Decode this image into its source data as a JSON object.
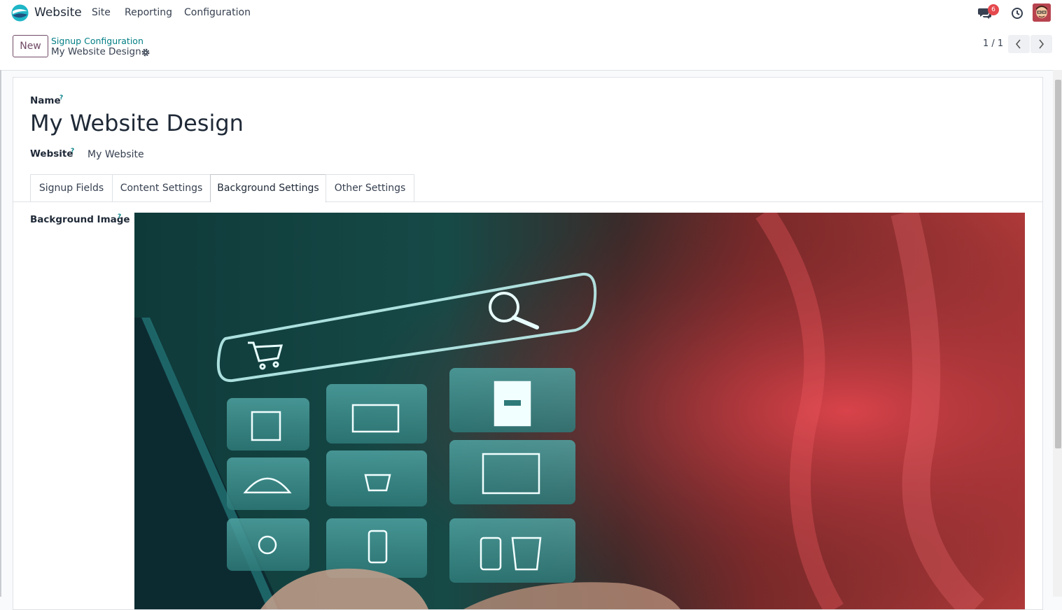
{
  "topbar": {
    "app_name": "Website",
    "menu": [
      "Site",
      "Reporting",
      "Configuration"
    ],
    "icons": {
      "chat": "chat-icon",
      "activity": "clock-icon",
      "avatar": "user-avatar"
    },
    "chat_badge": "6"
  },
  "control": {
    "new_label": "New",
    "breadcrumb_parent": "Signup Configuration",
    "breadcrumb_current": "My Website Design",
    "pager": "1 / 1"
  },
  "form": {
    "name_label": "Name",
    "help_mark": "?",
    "name_value": "My Website Design",
    "website_label": "Website",
    "website_value": "My Website",
    "tabs": [
      "Signup Fields",
      "Content Settings",
      "Background Settings",
      "Other Settings"
    ],
    "active_tab": "Background Settings",
    "background_image_label": "Background Image"
  },
  "colors": {
    "brand": "#714b67",
    "link": "#017e84",
    "badge": "#e5484d"
  }
}
